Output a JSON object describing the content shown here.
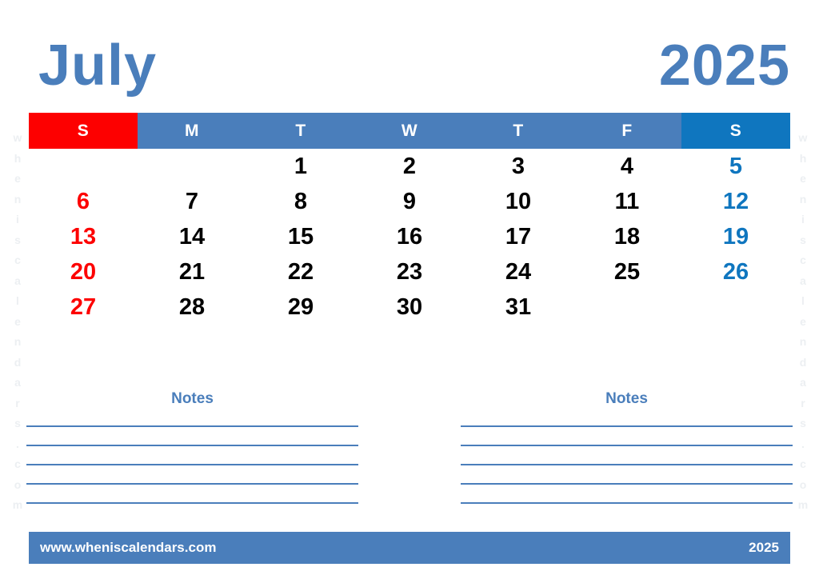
{
  "header": {
    "month": "July",
    "year": "2025"
  },
  "weekdays": [
    {
      "label": "S",
      "kind": "sun"
    },
    {
      "label": "M",
      "kind": "weekday"
    },
    {
      "label": "T",
      "kind": "weekday"
    },
    {
      "label": "W",
      "kind": "weekday"
    },
    {
      "label": "T",
      "kind": "weekday"
    },
    {
      "label": "F",
      "kind": "weekday"
    },
    {
      "label": "S",
      "kind": "sat"
    }
  ],
  "weeks": [
    [
      {
        "label": "",
        "kind": "empty"
      },
      {
        "label": "",
        "kind": "empty"
      },
      {
        "label": "1",
        "kind": "weekday"
      },
      {
        "label": "2",
        "kind": "weekday"
      },
      {
        "label": "3",
        "kind": "weekday"
      },
      {
        "label": "4",
        "kind": "weekday"
      },
      {
        "label": "5",
        "kind": "sat"
      }
    ],
    [
      {
        "label": "6",
        "kind": "sun"
      },
      {
        "label": "7",
        "kind": "weekday"
      },
      {
        "label": "8",
        "kind": "weekday"
      },
      {
        "label": "9",
        "kind": "weekday"
      },
      {
        "label": "10",
        "kind": "weekday"
      },
      {
        "label": "11",
        "kind": "weekday"
      },
      {
        "label": "12",
        "kind": "sat"
      }
    ],
    [
      {
        "label": "13",
        "kind": "sun"
      },
      {
        "label": "14",
        "kind": "weekday"
      },
      {
        "label": "15",
        "kind": "weekday"
      },
      {
        "label": "16",
        "kind": "weekday"
      },
      {
        "label": "17",
        "kind": "weekday"
      },
      {
        "label": "18",
        "kind": "weekday"
      },
      {
        "label": "19",
        "kind": "sat"
      }
    ],
    [
      {
        "label": "20",
        "kind": "sun"
      },
      {
        "label": "21",
        "kind": "weekday"
      },
      {
        "label": "22",
        "kind": "weekday"
      },
      {
        "label": "23",
        "kind": "weekday"
      },
      {
        "label": "24",
        "kind": "weekday"
      },
      {
        "label": "25",
        "kind": "weekday"
      },
      {
        "label": "26",
        "kind": "sat"
      }
    ],
    [
      {
        "label": "27",
        "kind": "sun"
      },
      {
        "label": "28",
        "kind": "weekday"
      },
      {
        "label": "29",
        "kind": "weekday"
      },
      {
        "label": "30",
        "kind": "weekday"
      },
      {
        "label": "31",
        "kind": "weekday"
      },
      {
        "label": "",
        "kind": "empty"
      },
      {
        "label": "",
        "kind": "empty"
      }
    ]
  ],
  "notes": {
    "left_title": "Notes",
    "right_title": "Notes",
    "line_count": 5
  },
  "footer": {
    "url": "www.wheniscalendars.com",
    "year": "2025"
  },
  "watermark": {
    "text": "wheniscalendars.com"
  },
  "colors": {
    "brand_blue": "#4a7ebb",
    "saturday_blue": "#0f76bf",
    "sunday_red": "#fd0000",
    "weekday_black": "#000000",
    "watermark_gray": "#eceff2"
  }
}
